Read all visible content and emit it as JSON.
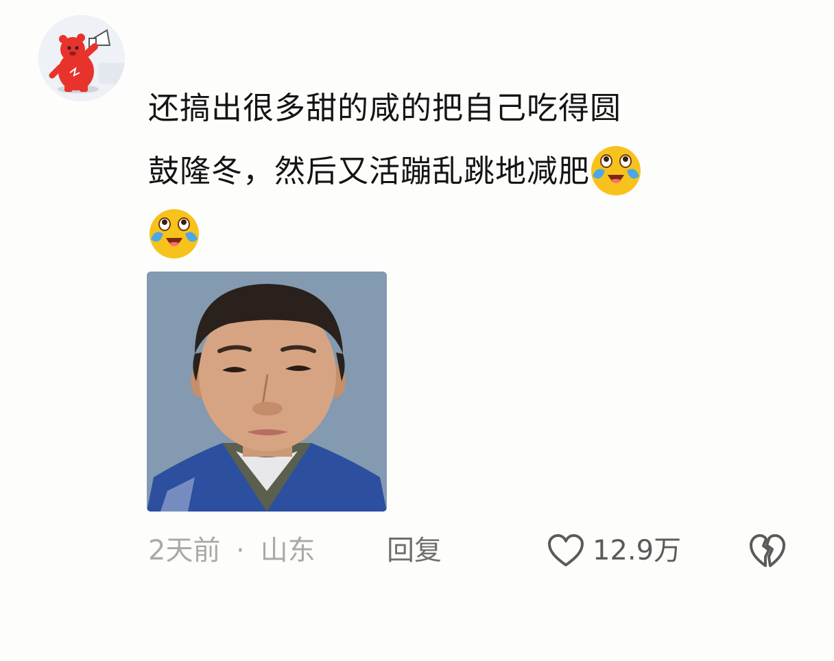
{
  "comment": {
    "text_line1": "还搞出很多甜的咸的把自己吃得圆",
    "text_line2": "鼓隆冬，然后又活蹦乱跳地减肥",
    "emoji_name": "laughing-crying-emoji"
  },
  "footer": {
    "time": "2天前",
    "separator": "·",
    "location": "山东",
    "reply_label": "回复",
    "like_count": "12.9万"
  },
  "icons": {
    "avatar": "red-bear-megaphone-avatar",
    "like": "heart-outline-icon",
    "dislike": "broken-heart-icon"
  },
  "colors": {
    "text": "#141414",
    "meta": "#a9a9a9",
    "reply": "#6e6e6e",
    "avatar_red": "#e8322c",
    "emoji_yellow": "#f8c21c"
  }
}
